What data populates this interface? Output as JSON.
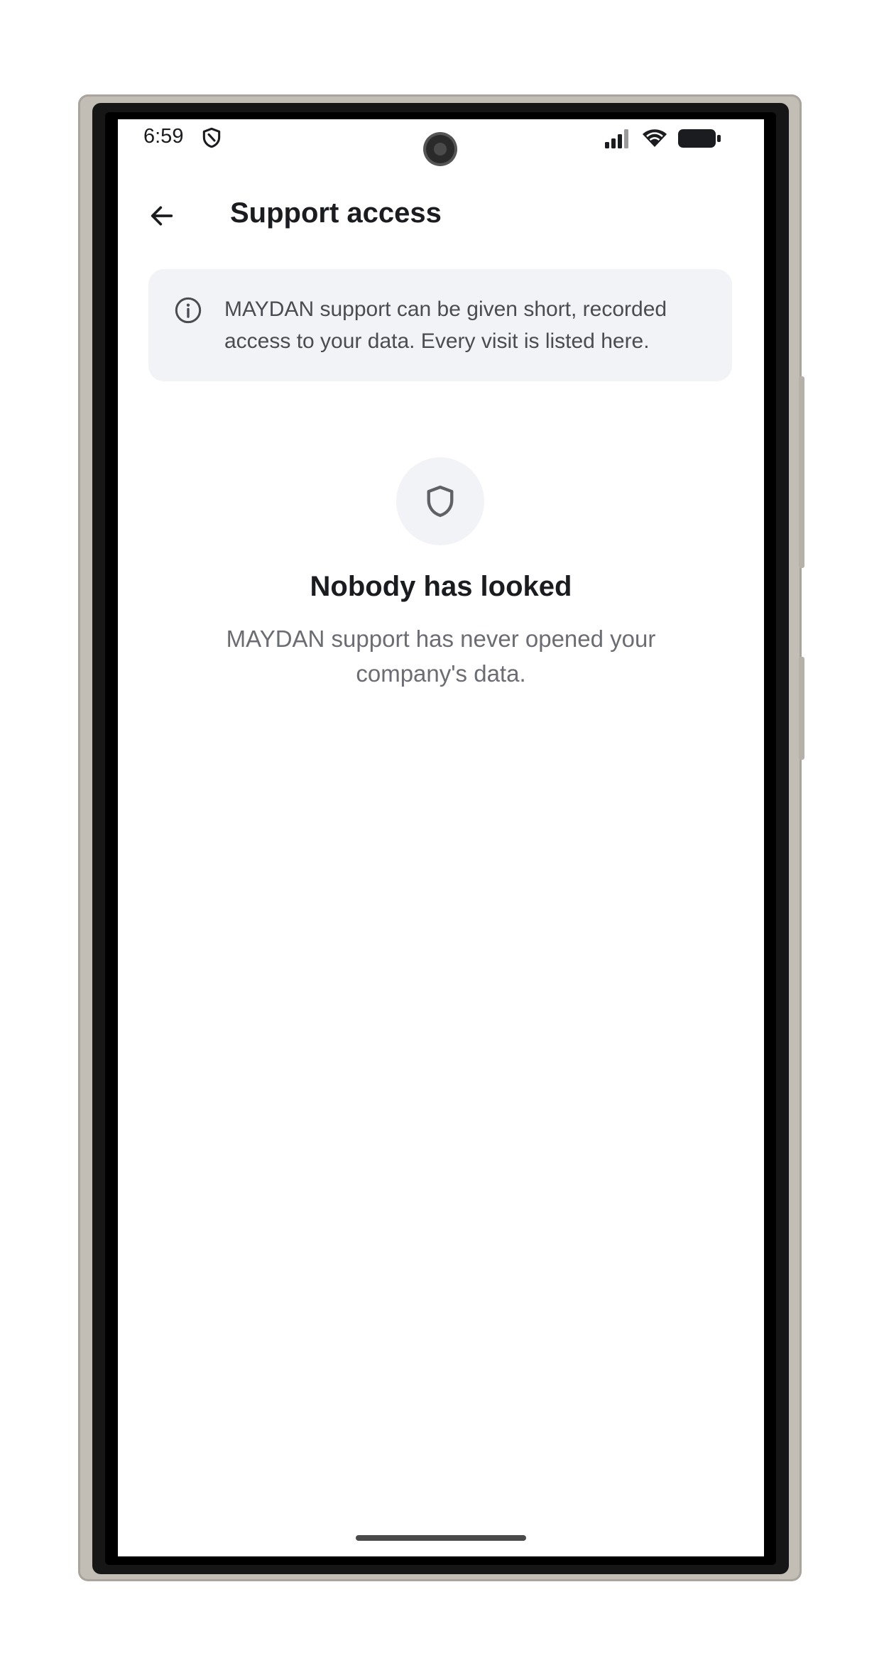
{
  "status_bar": {
    "time": "6:59",
    "icons": [
      "shield-icon",
      "signal-icon",
      "wifi-icon",
      "battery-icon"
    ]
  },
  "app_bar": {
    "back_icon": "arrow-back-icon",
    "title": "Support access"
  },
  "info_card": {
    "icon": "info-icon",
    "text": "MAYDAN support can be given short, recorded access to your data. Every visit is listed here."
  },
  "empty_state": {
    "icon": "shield-icon",
    "title": "Nobody has looked",
    "body": "MAYDAN support has never opened your company's data."
  },
  "colors": {
    "card_background": "#f2f3f6",
    "title_text": "#1b1c1f",
    "secondary_text": "#6b6d73"
  }
}
